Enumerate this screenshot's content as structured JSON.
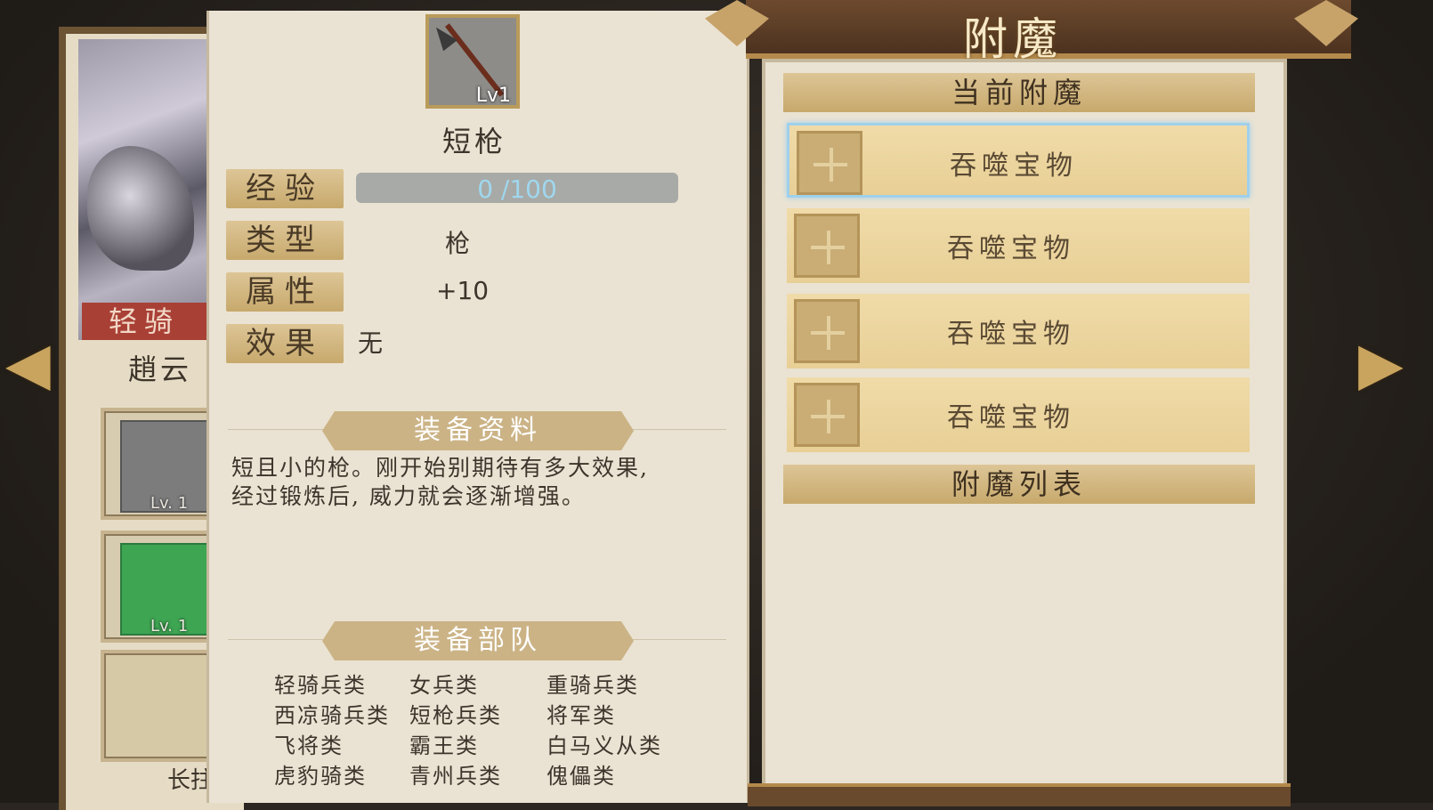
{
  "hero": {
    "class_badge": "轻骑",
    "name": "趙云",
    "equip_slots": [
      {
        "level": "Lv. 1"
      },
      {
        "level": "Lv. 1"
      }
    ],
    "bottom_caption": "长拄"
  },
  "item": {
    "level": "Lv1",
    "name": "短枪",
    "fields": {
      "exp_label": "经验",
      "exp_value": "0 /100",
      "type_label": "类型",
      "type_value": "枪",
      "attr_label": "属性",
      "attr_value": "+10",
      "effect_label": "效果",
      "effect_value": "无"
    },
    "info_section_title": "装备资料",
    "description_line1": "短且小的枪。刚开始别期待有多大效果,",
    "description_line2": "经过锻炼后, 威力就会逐渐增强。",
    "troops_section_title": "装备部队",
    "troops": [
      "轻骑兵类",
      "女兵类",
      "重骑兵类",
      "西凉骑兵类",
      "短枪兵类",
      "将军类",
      "飞将类",
      "霸王类",
      "白马义从类",
      "虎豹骑类",
      "青州兵类",
      "傀儡类"
    ]
  },
  "enchant": {
    "title": "附魔",
    "current_header": "当前附魔",
    "slots": [
      {
        "label": "吞噬宝物"
      },
      {
        "label": "吞噬宝物"
      },
      {
        "label": "吞噬宝物"
      },
      {
        "label": "吞噬宝物"
      }
    ],
    "list_header": "附魔列表"
  },
  "nav": {
    "prev_arrow": "◀",
    "next_arrow": "▶"
  },
  "colors": {
    "parchment": "#eae3d3",
    "label_gold": "#c7a96c",
    "slot_gold": "#e8cf96",
    "selected_border": "#9fd0ec",
    "class_badge_red": "#a94036",
    "exp_text_blue": "#9fd7ee"
  }
}
